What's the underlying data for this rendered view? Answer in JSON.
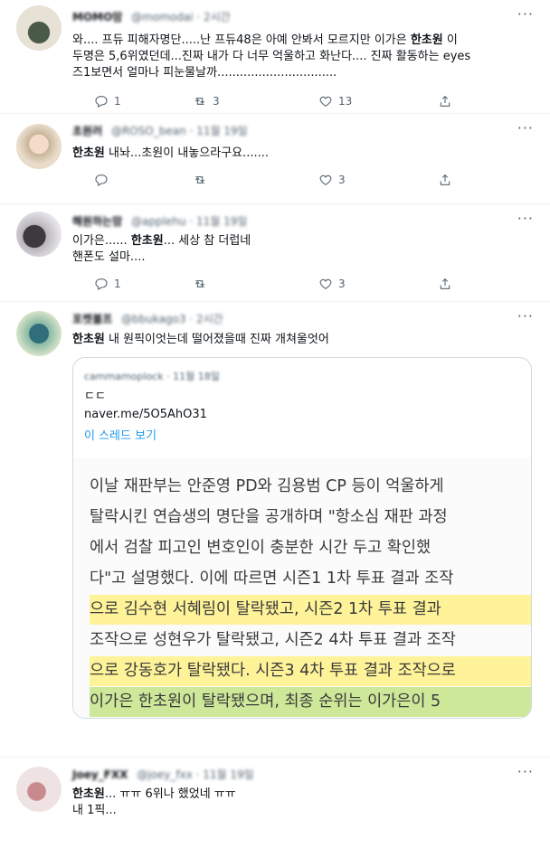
{
  "tweets": [
    {
      "author": "MOMO맘",
      "handle": "@momodai · 2시간",
      "lines": [
        {
          "parts": [
            "와.... 프듀 피해자명단.....난 프듀48은 아예 안봐서 모르지만 이가은 ",
            "한초원",
            " 이"
          ]
        },
        {
          "parts": [
            "두명은 5,6위였던데...진짜 내가 다 너무 억울하고 화난다.... 진짜 활동하는 eyes",
            "",
            ""
          ]
        },
        {
          "parts": [
            "즈1보면서 얼마나 피눈물날까................................",
            "",
            ""
          ]
        }
      ],
      "reply_count": "1",
      "retweet_count": "3",
      "like_count": "13"
    },
    {
      "author": "초원러",
      "handle": "@ROSO_bean · 11월 19일",
      "lines": [
        {
          "parts": [
            "",
            "한초원",
            " 내놔...초원이 내놓으라구요......."
          ]
        }
      ],
      "reply_count": "",
      "retweet_count": "",
      "like_count": "3"
    },
    {
      "author": "해원하는맘",
      "handle": "@applehu · 11월 19일",
      "lines": [
        {
          "parts": [
            "이가은...... ",
            "한초원",
            "... 세상 참 더럽네"
          ]
        },
        {
          "parts": [
            "핸폰도 설마....",
            "",
            ""
          ]
        }
      ],
      "reply_count": "1",
      "retweet_count": "",
      "like_count": "3"
    },
    {
      "author": "포켓볼프",
      "handle": "@bbukago3 · 2시간",
      "lines": [
        {
          "parts": [
            "",
            "한초원",
            " 내 원픽이엇는데 떨어졌을때 진짜 개쳐울엇어"
          ]
        }
      ],
      "quote": {
        "author": "cammamoplock · 11월 18일",
        "text1": "ㄷㄷ",
        "link": "naver.me/5O5AhO31",
        "thread": "이 스레드 보기",
        "article_lines": [
          "이날 재판부는 안준영 PD와 김용범 CP 등이 억울하게",
          "탈락시킨 연습생의 명단을 공개하며 \"항소심 재판 과정",
          "에서 검찰 피고인 변호인이 충분한 시간 두고 확인했",
          "다\"고 설명했다. 이에 따르면 시즌1 1차 투표 결과 조작",
          "으로 김수현 서혜림이 탈락됐고, 시즌2 1차 투표 결과",
          "조작으로 성현우가 탈락됐고, 시즌2 4차 투표 결과 조작",
          "으로 강동호가 탈락됐다. 시즌3 4차 투표 결과 조작으로",
          "이가은 한초원이 탈락됐으며, 최종 순위는 이가은이 5"
        ]
      }
    },
    {
      "author": "Joey_FXX",
      "handle": "@joey_fxx · 11월 19일",
      "lines": [
        {
          "parts": [
            "",
            "한초원",
            "... ㅠㅠ 6위나 했었네 ㅠㅠ"
          ]
        },
        {
          "parts": [
            "내 1픽...",
            "",
            ""
          ]
        }
      ]
    }
  ],
  "icons": {
    "more": "more-dots-icon",
    "reply": "reply-icon",
    "retweet": "retweet-icon",
    "like": "heart-icon",
    "share": "share-icon"
  },
  "colors": {
    "secondary": "#536471",
    "link": "#1d9bf0",
    "border": "#cfd9de"
  }
}
